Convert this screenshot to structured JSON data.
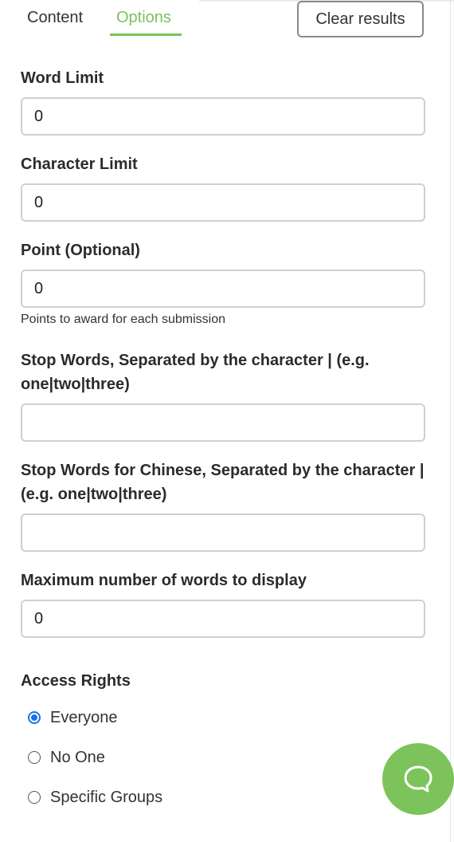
{
  "tabs": {
    "content": "Content",
    "options": "Options"
  },
  "clear_button": "Clear results",
  "fields": {
    "word_limit": {
      "label": "Word Limit",
      "value": "0"
    },
    "character_limit": {
      "label": "Character Limit",
      "value": "0"
    },
    "point": {
      "label": "Point (Optional)",
      "value": "0",
      "hint": "Points to award for each submission"
    },
    "stop_words": {
      "label": "Stop Words, Separated by the character | (e.g. one|two|three)",
      "value": ""
    },
    "stop_words_chinese": {
      "label": "Stop Words for Chinese, Separated by the character | (e.g. one|two|three)",
      "value": ""
    },
    "max_words": {
      "label": "Maximum number of words to display",
      "value": "0"
    }
  },
  "access_rights": {
    "label": "Access Rights",
    "options": [
      "Everyone",
      "No One",
      "Specific Groups"
    ],
    "selected": "Everyone"
  },
  "chat_button": {
    "icon": "chat-bubble-icon"
  },
  "colors": {
    "accent_green": "#79c35a",
    "radio_blue": "#1a73e8",
    "chat_green": "#7cc35b"
  }
}
